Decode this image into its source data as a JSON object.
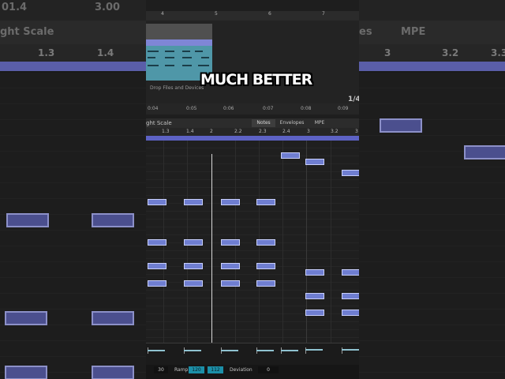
{
  "caption": "MUCH BETTER",
  "background": {
    "top_left": "01.4",
    "top_center": "3.00",
    "title": "ght Scale",
    "tab_right_1": "es",
    "tab_right_2": "MPE",
    "ruler": [
      "1.3",
      "1.4",
      "3",
      "3.2",
      "3.3"
    ]
  },
  "top_ruler": [
    "4",
    "5",
    "6",
    "7"
  ],
  "arrangement": {
    "drop_hint": "Drop Files and Devices",
    "time": [
      "0:04",
      "0:05",
      "0:06",
      "0:07",
      "0:08",
      "0:09"
    ],
    "fraction": "1/4"
  },
  "clip_header": {
    "scale_label": "ght Scale",
    "tabs": [
      "Notes",
      "Envelopes",
      "MPE"
    ]
  },
  "beat_ruler": [
    "1.3",
    "1.4",
    "2",
    "2.2",
    "2.3",
    "2.4",
    "3",
    "3.2",
    "3"
  ],
  "footer": {
    "value_1": "30",
    "ramp_label": "Ramp",
    "ramp_1": "120",
    "ramp_2": "112",
    "deviation_label": "Deviation",
    "deviation_value": "0"
  },
  "colors": {
    "note_fill": "#6f7ed1",
    "clip_teal": "#4f97a8",
    "accent": "#5d62c4"
  }
}
